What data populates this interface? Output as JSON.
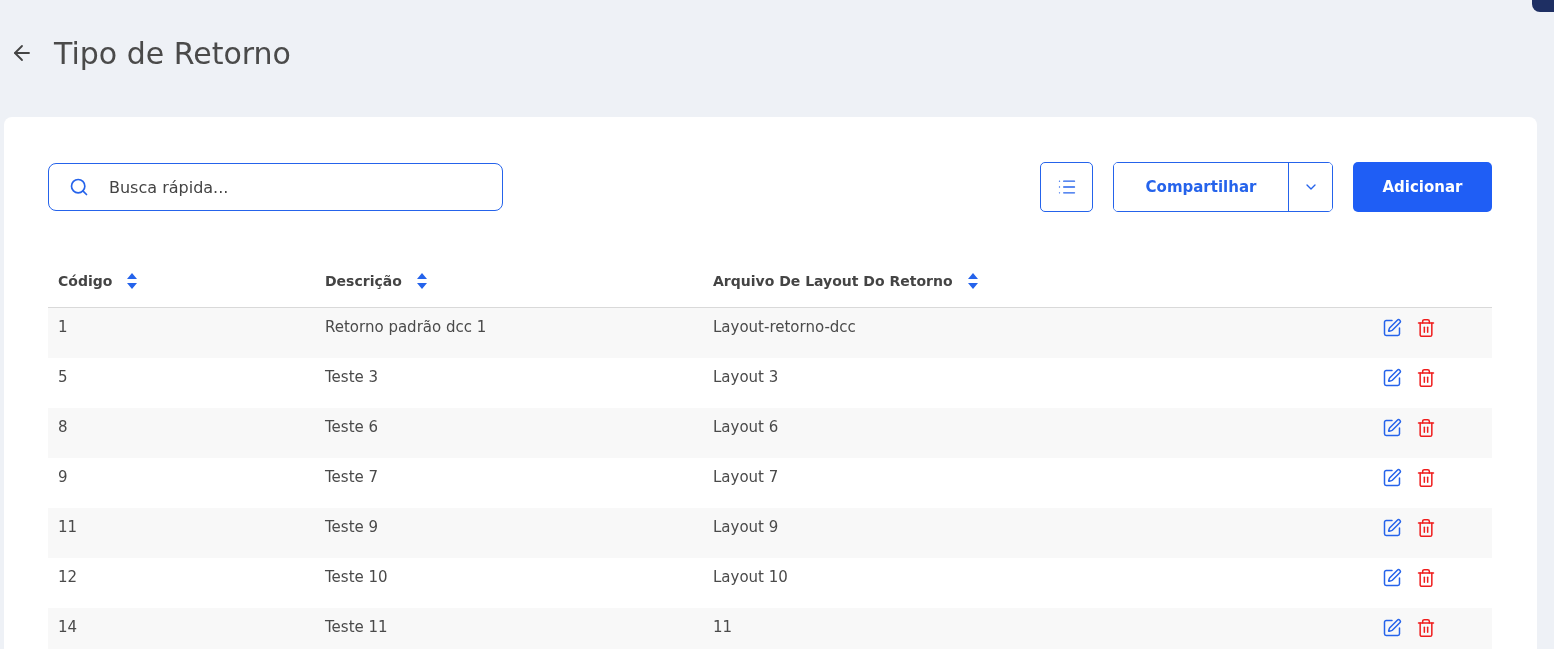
{
  "header": {
    "title": "Tipo de Retorno"
  },
  "toolbar": {
    "search": {
      "placeholder": "Busca rápida..."
    },
    "share_button": "Compartilhar",
    "add_button": "Adicionar"
  },
  "table": {
    "columns": [
      "Código",
      "Descrição",
      "Arquivo De Layout Do Retorno"
    ],
    "rows": [
      {
        "code": "1",
        "description": "Retorno padrão dcc 1",
        "layout_file": "Layout-retorno-dcc"
      },
      {
        "code": "5",
        "description": "Teste 3",
        "layout_file": "Layout 3"
      },
      {
        "code": "8",
        "description": "Teste 6",
        "layout_file": "Layout 6"
      },
      {
        "code": "9",
        "description": "Teste 7",
        "layout_file": "Layout 7"
      },
      {
        "code": "11",
        "description": "Teste 9",
        "layout_file": "Layout 9"
      },
      {
        "code": "12",
        "description": "Teste 10",
        "layout_file": "Layout 10"
      },
      {
        "code": "14",
        "description": "Teste 11",
        "layout_file": "11"
      }
    ]
  }
}
